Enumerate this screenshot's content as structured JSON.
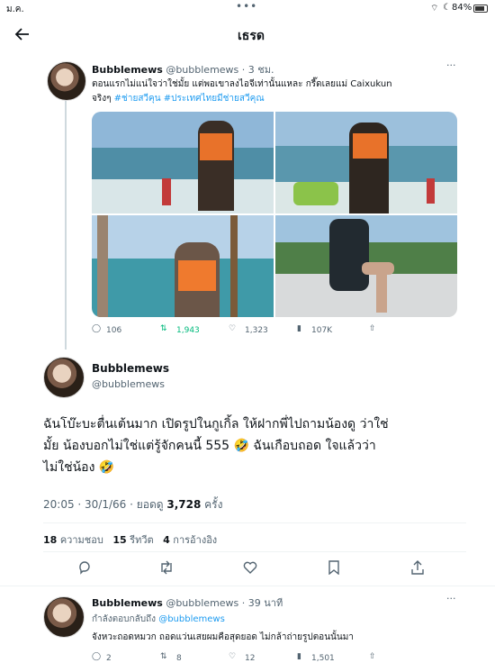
{
  "status": {
    "time": "ม.ค.",
    "battery": "84%"
  },
  "header": {
    "title": "เธรด"
  },
  "quoted": {
    "name": "Bubblemews",
    "handle": "@bubblemews",
    "time": "· 3 ชม.",
    "text_line1": "ตอนแรกไม่แน่ใจว่าใช่มั้ย แต่พอเขาลงไอจีเท่านั้นแหละ กรี๊ดเลยแม่ Caixukun",
    "text_line2_prefix": "จริงๆ ",
    "hashtag1": "#ช่ายสวีคุน",
    "hashtag2": "#ประเทศไทยมีช่ายสวีคุณ",
    "stats": {
      "replies": "106",
      "retweets": "1,943",
      "likes": "1,323",
      "views": "107K"
    }
  },
  "main": {
    "name": "Bubblemews",
    "handle": "@bubblemews",
    "text_line1": "ฉันโบ๊ะบะตื่นเต้นมาก เปิดรูปในกูเกิ้ล ให้ฝากพี่ไปถามน้องดู ว่าใช่",
    "text_line2": "มั้ย น้องบอกไม่ใช่แต่รู้จักคนนี้ 555 🤣  ฉันเกือบถอด ใจแล้วว่า",
    "text_line3": "ไม่ใช่น้อง 🤣",
    "time": "20:05 · 30/1/66 · ยอดดู ",
    "views_count": "3,728",
    "views_suffix": " ครั้ง",
    "likes_count": "18",
    "likes_label": "ความชอบ",
    "retweets_count": "15",
    "retweets_label": "รีทวีต",
    "quotes_count": "4",
    "quotes_label": "การอ้างอิง"
  },
  "reply": {
    "name": "Bubblemews",
    "handle": "@bubblemews",
    "time": "· 39 นาที",
    "replying_prefix": "กำลังตอบกลับถึง ",
    "replying_to": "@bubblemews",
    "text": "จังหวะถอดหมวก ถอดแว่นเสยผมคือสุดยอด ไม่กล้าถ่ายรูปตอนนั้นมา",
    "stats": {
      "replies": "2",
      "retweets": "8",
      "likes": "12",
      "views": "1,501"
    }
  },
  "colors": {
    "accent": "#1d9bf0",
    "retweet_active": "#00ba7c"
  }
}
